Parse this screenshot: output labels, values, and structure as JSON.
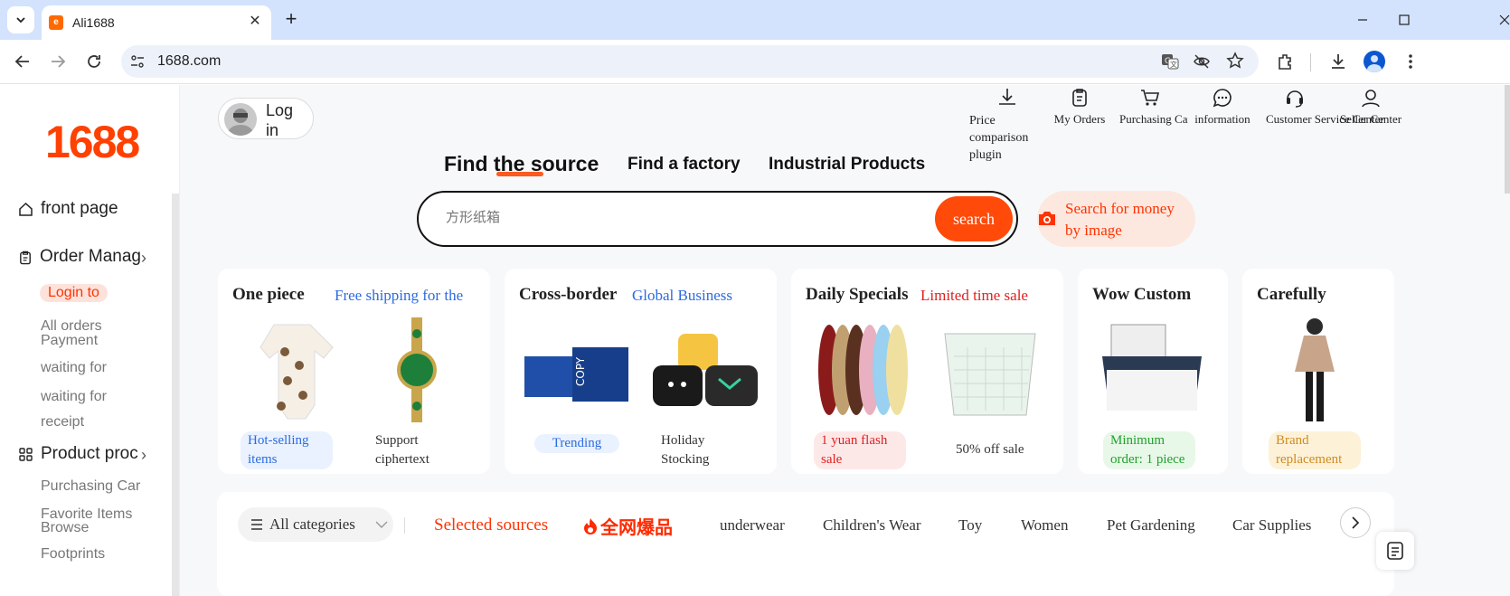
{
  "browser": {
    "tab_title": "Ali1688",
    "favicon_text": "e",
    "url": "1688.com",
    "icons": [
      "tab-search-icon",
      "close-tab-icon",
      "new-tab-icon",
      "minimize-icon",
      "maximize-icon",
      "close-window-icon",
      "back-icon",
      "forward-icon",
      "reload-icon",
      "site-info-icon",
      "translate-icon",
      "eye-off-icon",
      "star-icon",
      "extensions-icon",
      "download-icon",
      "profile-icon",
      "menu-icon"
    ]
  },
  "sidebar": {
    "logo": "1688",
    "front_page": "front page",
    "order_management": "Order Manag",
    "login_to": "Login to",
    "all_orders": "All orders",
    "payment": "Payment",
    "waiting_for_1": "waiting for",
    "waiting_for_2": "waiting for",
    "receipt": "receipt",
    "product": "Product proc",
    "purchasing_car": "Purchasing Car",
    "favorite_items": "Favorite Items",
    "browse": "Browse",
    "footprints": "Footprints"
  },
  "header": {
    "login_label": "Log in",
    "nav": [
      {
        "label": "Price comparison plugin",
        "icon": "download-icon"
      },
      {
        "label": "My Orders",
        "icon": "clipboard-icon"
      },
      {
        "label": "Purchasing Car",
        "icon": "cart-icon"
      },
      {
        "label": "information",
        "icon": "chat-icon"
      },
      {
        "label": "Customer Service Center",
        "icon": "headset-icon"
      },
      {
        "label": "Seller Center",
        "icon": "user-icon"
      }
    ]
  },
  "search": {
    "tabs": [
      "Find the source",
      "Find a factory",
      "Industrial Products"
    ],
    "placeholder": "方形纸箱",
    "button": "search",
    "image_search": "Search for money by image"
  },
  "cards": [
    {
      "title": "One piece",
      "subtitle": "Free shipping for the",
      "tag1": "Hot-selling items",
      "tag2": "Support ciphertext",
      "sub_color": "#2c6be0"
    },
    {
      "title": "Cross-border",
      "subtitle": "Global Business",
      "tag1": "Trending",
      "tag2": "Holiday Stocking",
      "sub_color": "#2c6be0"
    },
    {
      "title": "Daily Specials",
      "subtitle": "Limited time sale",
      "tag1": "1 yuan flash sale",
      "tag2": "50% off sale",
      "sub_color": "#e02020"
    },
    {
      "title": "Wow Custom",
      "tag1": "Minimum order: 1 piece"
    },
    {
      "title": "Carefully",
      "tag1": "Brand replacement"
    }
  ],
  "categories": {
    "all": "All categories",
    "selected": "Selected sources",
    "hot_badge": "全网爆品",
    "items": [
      "underwear",
      "Children's Wear",
      "Toy",
      "Women",
      "Pet Gardening",
      "Car Supplies"
    ]
  },
  "colors": {
    "brand": "#ff4000",
    "tab_bar": "#d3e3fd",
    "accent_blue": "#2c6be0"
  }
}
